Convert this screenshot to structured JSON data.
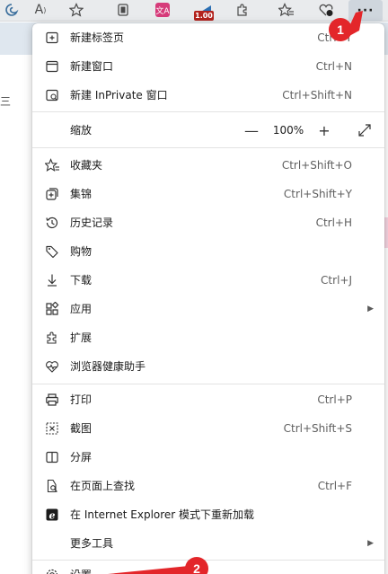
{
  "toolbar": {
    "icons": [
      "edge-icon",
      "read-aloud-icon",
      "favorite-star-icon",
      "collections-tab-icon",
      "translate-extension-icon",
      "speed-extension-icon",
      "extensions-puzzle-icon",
      "favorites-list-icon",
      "browser-essentials-icon"
    ],
    "read_aloud_label": "A",
    "ext_badge": "1.00",
    "more_label": "···"
  },
  "menu": {
    "new_tab": "新建标签页",
    "new_tab_shortcut": "Ctrl+T",
    "new_window": "新建窗口",
    "new_window_shortcut": "Ctrl+N",
    "new_inprivate": "新建 InPrivate 窗口",
    "new_inprivate_shortcut": "Ctrl+Shift+N",
    "zoom": "缩放",
    "zoom_minus": "—",
    "zoom_value": "100%",
    "zoom_plus": "+",
    "favorites": "收藏夹",
    "favorites_shortcut": "Ctrl+Shift+O",
    "collections": "集锦",
    "collections_shortcut": "Ctrl+Shift+Y",
    "history": "历史记录",
    "history_shortcut": "Ctrl+H",
    "shopping": "购物",
    "downloads": "下载",
    "downloads_shortcut": "Ctrl+J",
    "apps": "应用",
    "extensions": "扩展",
    "browser_essentials": "浏览器健康助手",
    "print": "打印",
    "print_shortcut": "Ctrl+P",
    "screenshot": "截图",
    "screenshot_shortcut": "Ctrl+Shift+S",
    "split_screen": "分屏",
    "find_on_page": "在页面上查找",
    "find_on_page_shortcut": "Ctrl+F",
    "ie_mode": "在 Internet Explorer 模式下重新加载",
    "more_tools": "更多工具",
    "settings": "设置"
  },
  "annotations": {
    "step1": "1",
    "step2": "2",
    "color": "#e3262a"
  },
  "page": {
    "left_glyph": "三"
  }
}
